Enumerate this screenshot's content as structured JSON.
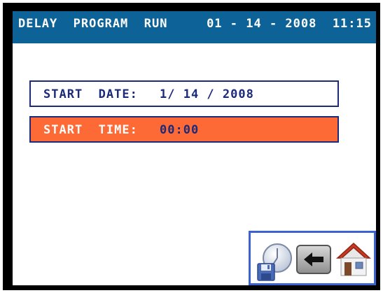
{
  "header": {
    "title": "DELAY  PROGRAM  RUN",
    "datetime": "01 - 14 - 2008  11:15"
  },
  "fields": {
    "start_date": {
      "label": "START  DATE:",
      "value": "1/ 14 / 2008"
    },
    "start_time": {
      "label": "START  TIME:",
      "value": "00:00"
    }
  },
  "toolbar": {
    "icons": [
      "save-clock-icon",
      "back-arrow-icon",
      "home-icon"
    ]
  },
  "colors": {
    "header_bg": "#0d6398",
    "selected_field_bg": "#fd6a35",
    "field_border": "#1c2a7a",
    "toolbar_border": "#3a62d0"
  }
}
